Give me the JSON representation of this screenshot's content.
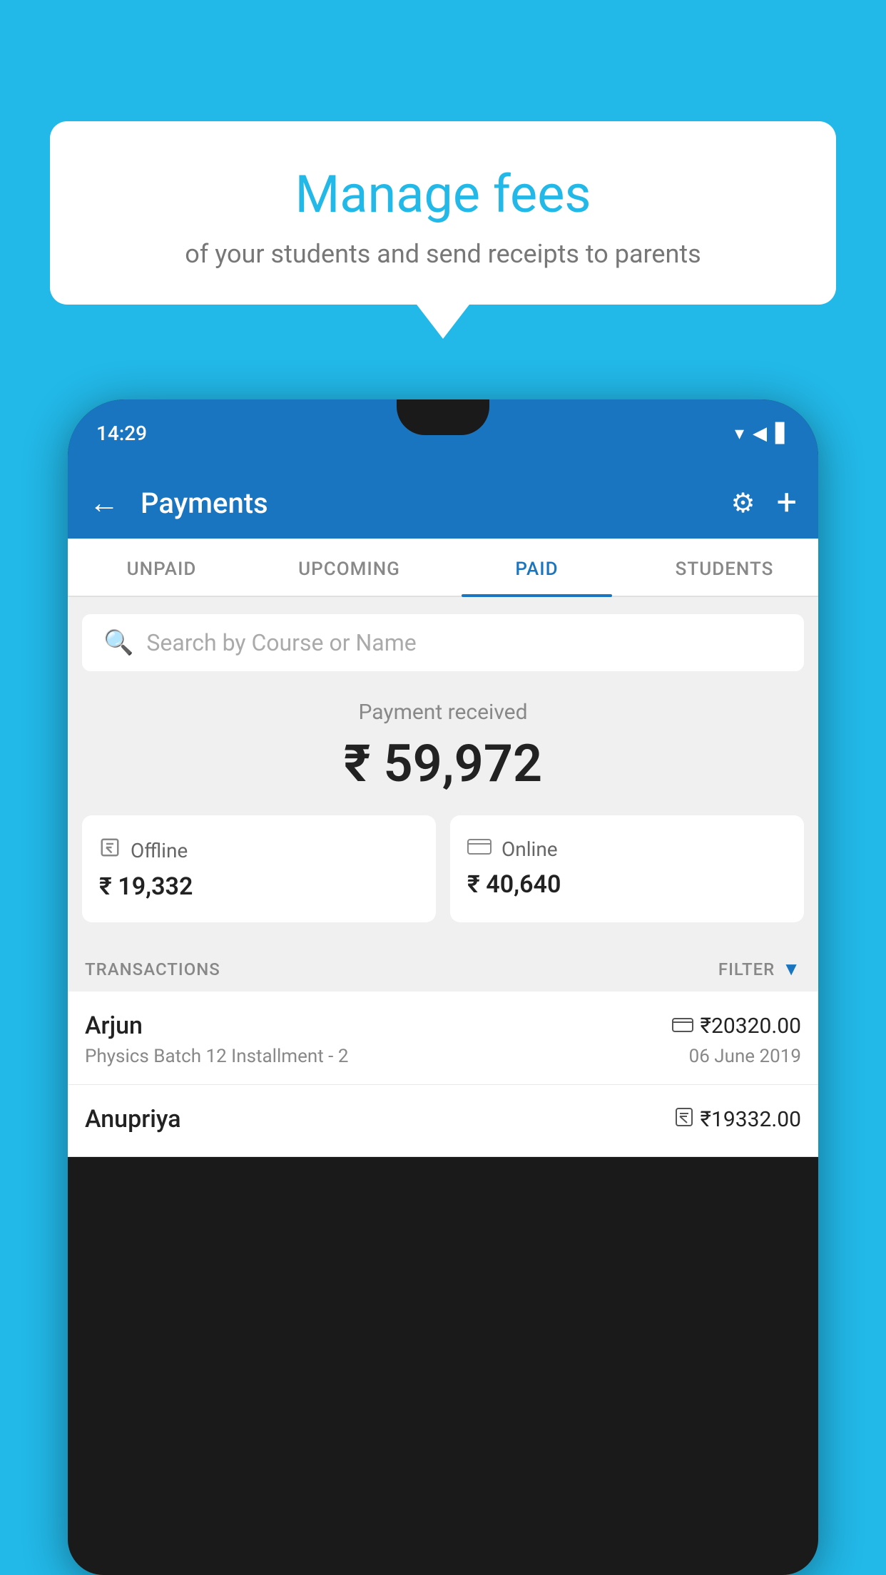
{
  "background_color": "#22B8E8",
  "bubble": {
    "title": "Manage fees",
    "subtitle": "of your students and send receipts to parents"
  },
  "status_bar": {
    "time": "14:29",
    "icons": [
      "▾",
      "◀",
      "▋"
    ]
  },
  "header": {
    "title": "Payments",
    "back_icon": "←",
    "settings_icon": "⚙",
    "add_icon": "+"
  },
  "tabs": [
    {
      "label": "UNPAID",
      "active": false
    },
    {
      "label": "UPCOMING",
      "active": false
    },
    {
      "label": "PAID",
      "active": true
    },
    {
      "label": "STUDENTS",
      "active": false
    }
  ],
  "search": {
    "placeholder": "Search by Course or Name"
  },
  "payment_received": {
    "label": "Payment received",
    "amount": "₹ 59,972"
  },
  "payment_cards": [
    {
      "icon": "offline",
      "mode": "Offline",
      "amount": "₹ 19,332"
    },
    {
      "icon": "online",
      "mode": "Online",
      "amount": "₹ 40,640"
    }
  ],
  "transactions_label": "TRANSACTIONS",
  "filter_label": "FILTER",
  "transactions": [
    {
      "name": "Arjun",
      "amount": "₹20320.00",
      "course": "Physics Batch 12 Installment - 2",
      "date": "06 June 2019",
      "mode_icon": "card"
    },
    {
      "name": "Anupriya",
      "amount": "₹19332.00",
      "course": "",
      "date": "",
      "mode_icon": "rupee"
    }
  ]
}
